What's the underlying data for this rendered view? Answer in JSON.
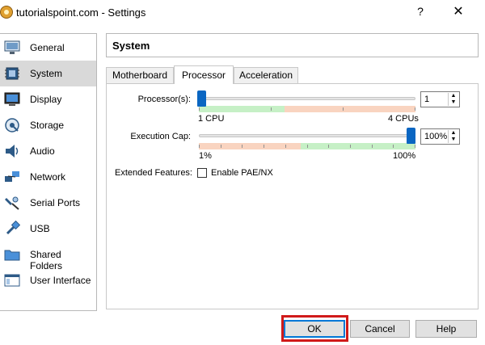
{
  "window": {
    "title": "tutorialspoint.com - Settings",
    "help_glyph": "?",
    "close_glyph": "✕"
  },
  "sidebar": {
    "items": [
      {
        "label": "General",
        "icon": "monitor-icon"
      },
      {
        "label": "System",
        "icon": "chip-icon",
        "selected": true
      },
      {
        "label": "Display",
        "icon": "display-icon"
      },
      {
        "label": "Storage",
        "icon": "storage-icon"
      },
      {
        "label": "Audio",
        "icon": "speaker-icon"
      },
      {
        "label": "Network",
        "icon": "network-icon"
      },
      {
        "label": "Serial Ports",
        "icon": "serial-port-icon"
      },
      {
        "label": "USB",
        "icon": "usb-icon"
      },
      {
        "label": "Shared Folders",
        "icon": "folder-icon"
      },
      {
        "label": "User Interface",
        "icon": "window-icon"
      }
    ]
  },
  "panel": {
    "title": "System",
    "tabs": [
      {
        "label": "Motherboard"
      },
      {
        "label": "Processor",
        "active": true
      },
      {
        "label": "Acceleration"
      }
    ]
  },
  "processor": {
    "cpu_label": "Processor(s):",
    "cpu_value": "1",
    "cpu_min_label": "1 CPU",
    "cpu_max_label": "4 CPUs",
    "cpu_min": 1,
    "cpu_max": 4,
    "cpu_current": 1,
    "cap_label": "Execution Cap:",
    "cap_value": "100%",
    "cap_min_label": "1%",
    "cap_max_label": "100%",
    "cap_current_percent": 100,
    "extended_label": "Extended Features:",
    "pae_label": "Enable PAE/NX",
    "pae_checked": false
  },
  "buttons": {
    "ok": "OK",
    "cancel": "Cancel",
    "help": "Help"
  },
  "colors": {
    "accent": "#0a66c2",
    "good_band": "#c6f0c6",
    "warn_band": "#f9d4c0",
    "highlight": "#d01a1a",
    "selected_row": "#d9d9d9"
  }
}
